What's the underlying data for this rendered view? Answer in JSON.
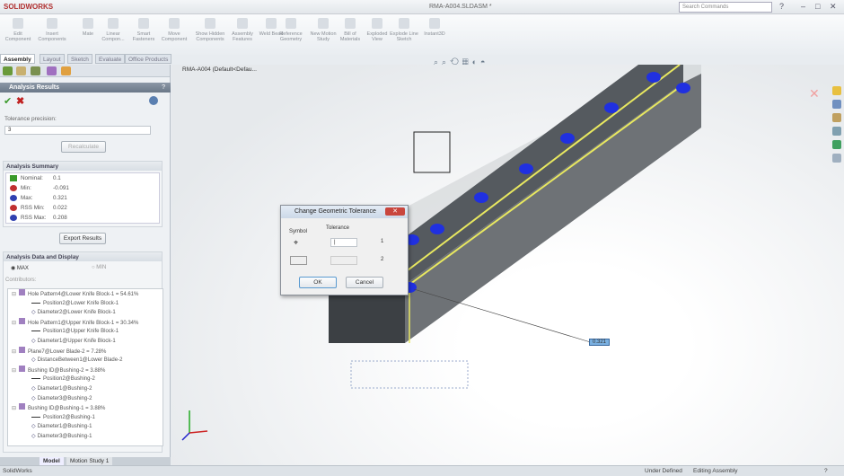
{
  "app": {
    "logo": "SOLIDWORKS",
    "document_title": "RMA-A004.SLDASM *",
    "search_placeholder": "Search Commands"
  },
  "ribbon": [
    "Edit Component",
    "Insert Components",
    "Mate",
    "Linear Compon...",
    "Smart Fasteners",
    "Move Component",
    "Show Hidden Components",
    "Assembly Features",
    "Weld Bead",
    "Reference Geometry",
    "New Motion Study",
    "Bill of Materials",
    "Exploded View",
    "Explode Line Sketch",
    "Instant3D"
  ],
  "tabs": [
    "Assembly",
    "Layout",
    "Sketch",
    "Evaluate",
    "Office Products"
  ],
  "panel": {
    "title": "Analysis Results",
    "help": "?",
    "tolerance_label": "Tolerance precision:",
    "tolerance_value": "3",
    "recalculate": "Recalculate",
    "summary_title": "Analysis Summary",
    "summary": [
      {
        "label": "Nominal:",
        "value": "0.1",
        "color": "#3a9a2a"
      },
      {
        "label": "Min:",
        "value": "-0.091",
        "color": "#c03030"
      },
      {
        "label": "Max:",
        "value": "0.321",
        "color": "#3040b0"
      },
      {
        "label": "RSS Min:",
        "value": "0.022",
        "color": "#c03030"
      },
      {
        "label": "RSS Max:",
        "value": "0.208",
        "color": "#3040b0"
      }
    ],
    "export": "Export Results",
    "data_title": "Analysis Data and Display",
    "radio_max": "MAX",
    "radio_min": "MIN",
    "contributors_label": "Contributors:",
    "tree": [
      {
        "level": 0,
        "text": "Hole Pattern4@Lower Knife Block-1 = 54.61%"
      },
      {
        "level": 1,
        "text": "Position2@Lower Knife Block-1",
        "kind": "line"
      },
      {
        "level": 1,
        "text": "Diameter2@Lower Knife Block-1"
      },
      {
        "level": 0,
        "text": "Hole Pattern1@Upper Knife Block-1 = 30.34%"
      },
      {
        "level": 1,
        "text": "Position1@Upper Knife Block-1",
        "kind": "line"
      },
      {
        "level": 1,
        "text": "Diameter1@Upper Knife Block-1"
      },
      {
        "level": 0,
        "text": "Plane7@Lower Blade-2 = 7.28%"
      },
      {
        "level": 1,
        "text": "DistanceBetween1@Lower Blade-2"
      },
      {
        "level": 0,
        "text": "Bushing ID@Bushing-2 = 3.88%"
      },
      {
        "level": 1,
        "text": "Position2@Bushing-2",
        "kind": "line"
      },
      {
        "level": 1,
        "text": "Diameter1@Bushing-2"
      },
      {
        "level": 1,
        "text": "Diameter3@Bushing-2"
      },
      {
        "level": 0,
        "text": "Bushing ID@Bushing-1 = 3.88%"
      },
      {
        "level": 1,
        "text": "Position2@Bushing-1",
        "kind": "line"
      },
      {
        "level": 1,
        "text": "Diameter1@Bushing-1"
      },
      {
        "level": 1,
        "text": "Diameter3@Bushing-1"
      }
    ]
  },
  "bottom_tabs": [
    "Model",
    "Motion Study 1"
  ],
  "viewport": {
    "tree_root": "RMA-A004 (Default<Defau...",
    "callout_value": "0.321"
  },
  "dialog": {
    "title": "Change Geometric Tolerance",
    "symbol": "Symbol",
    "tolerance": "Tolerance",
    "tol_value": "|",
    "row1": "1",
    "row2": "2",
    "ok": "OK",
    "cancel": "Cancel",
    "close": "✕"
  },
  "status": {
    "app": "SolidWorks",
    "state": "Under Defined",
    "mode": "Editing Assembly",
    "help": "?"
  }
}
